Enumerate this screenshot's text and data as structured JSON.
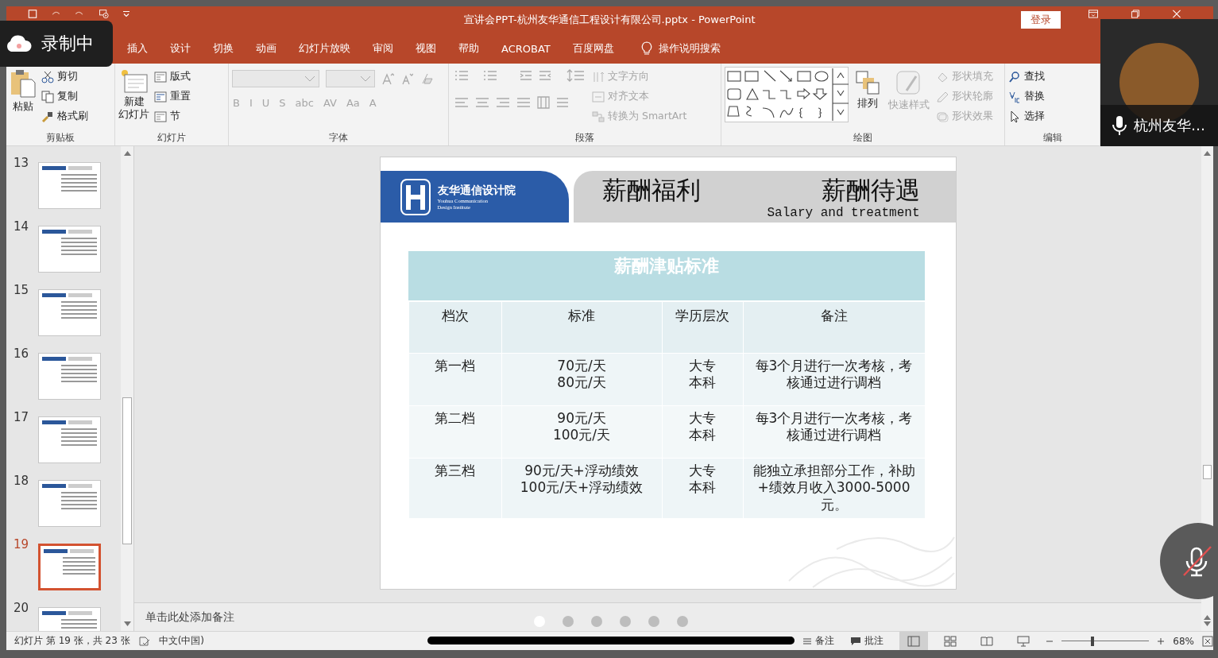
{
  "recording_badge": {
    "label": "录制中"
  },
  "window": {
    "title": "宣讲会PPT-杭州友华通信工程设计有限公司.pptx  -  PowerPoint",
    "login_button": "登录"
  },
  "menu_tabs": [
    {
      "label": "插入",
      "selected": false
    },
    {
      "label": "设计",
      "selected": false
    },
    {
      "label": "切换",
      "selected": false
    },
    {
      "label": "动画",
      "selected": false
    },
    {
      "label": "幻灯片放映",
      "selected": false
    },
    {
      "label": "审阅",
      "selected": false
    },
    {
      "label": "视图",
      "selected": false
    },
    {
      "label": "帮助",
      "selected": false
    },
    {
      "label": "ACROBAT",
      "selected": false
    },
    {
      "label": "百度网盘",
      "selected": false
    }
  ],
  "tell_me": "操作说明搜索",
  "ribbon": {
    "clipboard": {
      "title": "剪贴板",
      "paste": "粘贴",
      "items": [
        {
          "kind": "cut",
          "label": "剪切"
        },
        {
          "kind": "copy",
          "label": "复制"
        },
        {
          "kind": "painter",
          "label": "格式刷"
        }
      ]
    },
    "slides": {
      "title": "幻灯片",
      "new_slide": [
        "新建",
        "幻灯片"
      ],
      "items": [
        {
          "kind": "layout",
          "label": "版式"
        },
        {
          "kind": "reset",
          "label": "重置"
        },
        {
          "kind": "section",
          "label": "节"
        }
      ]
    },
    "font": {
      "title": "字体",
      "disabled": true,
      "buttons": [
        "B",
        "I",
        "U",
        "S",
        "abc",
        "AV",
        "Aa",
        "A"
      ]
    },
    "paragraph": {
      "title": "段落",
      "disabled": true,
      "items": [
        {
          "kind": "direction",
          "label": "文字方向"
        },
        {
          "kind": "align",
          "label": "对齐文本"
        },
        {
          "kind": "smartart",
          "label": "转换为 SmartArt"
        }
      ]
    },
    "drawing": {
      "title": "绘图",
      "arrange": "排列",
      "quick_styles": {
        "label": "快速样式",
        "disabled": true
      },
      "items": [
        {
          "kind": "fill",
          "label": "形状填充",
          "disabled": true
        },
        {
          "kind": "outline",
          "label": "形状轮廓",
          "disabled": true
        },
        {
          "kind": "effects",
          "label": "形状效果",
          "disabled": true
        }
      ]
    },
    "editing": {
      "title": "编辑",
      "items": [
        {
          "kind": "find",
          "label": "查找"
        },
        {
          "kind": "replace",
          "label": "替换"
        },
        {
          "kind": "select",
          "label": "选择"
        }
      ]
    }
  },
  "thumbnails": [
    {
      "number": "13",
      "selected": false
    },
    {
      "number": "14",
      "selected": false
    },
    {
      "number": "15",
      "selected": false
    },
    {
      "number": "16",
      "selected": false
    },
    {
      "number": "17",
      "selected": false
    },
    {
      "number": "18",
      "selected": false
    },
    {
      "number": "19",
      "selected": true
    },
    {
      "number": "20",
      "selected": false
    }
  ],
  "slide": {
    "logo_name": "友华通信设计院",
    "logo_en": [
      "Youhua Communication",
      "Design Institute"
    ],
    "title_left": "薪酬福利",
    "title_right": "薪酬待遇",
    "subtitle": "Salary and treatment",
    "table": {
      "title": "薪酬津贴标准",
      "columns": [
        "档次",
        "标准",
        "学历层次",
        "备注"
      ],
      "rows": [
        [
          "第一档",
          "70元/天\n80元/天",
          "大专本科",
          "每3个月进行一次考核，考核通过进行调档"
        ],
        [
          "第二档",
          "90元/天\n100元/天",
          "大专本科",
          "每3个月进行一次考核，考核通过进行调档"
        ],
        [
          "第三档",
          "90元/天+浮动绩效\n100元/天+浮动绩效",
          "大专本科",
          "能独立承担部分工作，补助+绩效月收入3000-5000元。"
        ]
      ]
    }
  },
  "notes_placeholder": "单击此处添加备注",
  "page_dots": [
    {
      "selected": true
    },
    {
      "selected": false
    },
    {
      "selected": false
    },
    {
      "selected": false
    },
    {
      "selected": false
    },
    {
      "selected": false
    }
  ],
  "video": {
    "name": "杭州友华…"
  },
  "status_bar": {
    "slide_info": "幻灯片 第 19 张，共 23 张",
    "language": "中文(中国)",
    "notes": "备注",
    "comments": "批注",
    "views": [
      {
        "kind": "normal",
        "selected": true
      },
      {
        "kind": "sorter",
        "selected": false
      },
      {
        "kind": "reading",
        "selected": false
      },
      {
        "kind": "show",
        "selected": false
      }
    ],
    "zoom": {
      "level": 0.33,
      "reading": "68%"
    }
  }
}
